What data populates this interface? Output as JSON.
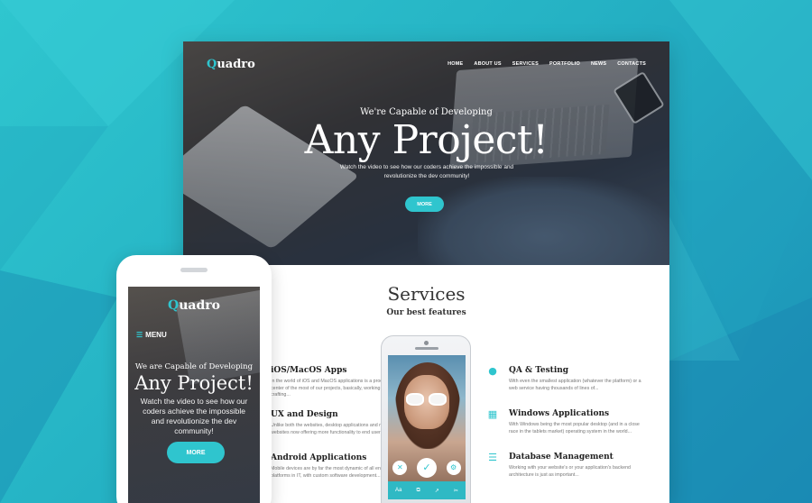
{
  "colors": {
    "accent": "#2fc5ce",
    "background": "#25b2c4"
  },
  "brand": {
    "logo_initial": "Q",
    "logo_rest": "uadro"
  },
  "nav": {
    "items": [
      "HOME",
      "ABOUT US",
      "SERVICES",
      "PORTFOLIO",
      "NEWS",
      "CONTACTS"
    ]
  },
  "hero": {
    "subtitle": "We're Capable of Developing",
    "title": "Any Project!",
    "description": "Watch the video to see how our coders achieve the impossible and revolutionize the dev community!",
    "button": "MORE"
  },
  "services": {
    "title": "Services",
    "subtitle": "Our best features",
    "left": [
      {
        "icon": "apple-icon",
        "title": "iOS/MacOS Apps",
        "text": "In the world of iOS and MacOS applications is a product and center of the most of our projects, basically, working on crafting..."
      },
      {
        "icon": "design-icon",
        "title": "UX and Design",
        "text": "Unlike both the websites, desktop applications and mobile websites now offering more functionality to end users, that..."
      },
      {
        "icon": "android-icon",
        "title": "Android Applications",
        "text": "Mobile devices are by far the most dynamic of all enterprise platforms in IT, with custom software development..."
      }
    ],
    "right": [
      {
        "icon": "chat-icon",
        "title": "QA & Testing",
        "text": "With even the smallest application (whatever the platform) or a web service having thousands of lines of..."
      },
      {
        "icon": "windows-icon",
        "title": "Windows Applications",
        "text": "With Windows being the most popular desktop (and in a close race in the tablets market) operating system in the world..."
      },
      {
        "icon": "database-icon",
        "title": "Database Management",
        "text": "Working with your website's or your application's backend architecture is just as important..."
      }
    ]
  },
  "phone_app": {
    "tabs": [
      "Aa",
      "⧉",
      "↗",
      "✂"
    ],
    "controls": [
      "✕",
      "✓",
      "⚙"
    ]
  },
  "mobile": {
    "logo_initial": "Q",
    "logo_rest": "uadro",
    "menu": "MENU",
    "subtitle": "We are Capable of Developing",
    "title": "Any Project!",
    "description": "Watch the video to see how our coders achieve the impossible and revolutionize the dev community!",
    "button": "MORE"
  }
}
